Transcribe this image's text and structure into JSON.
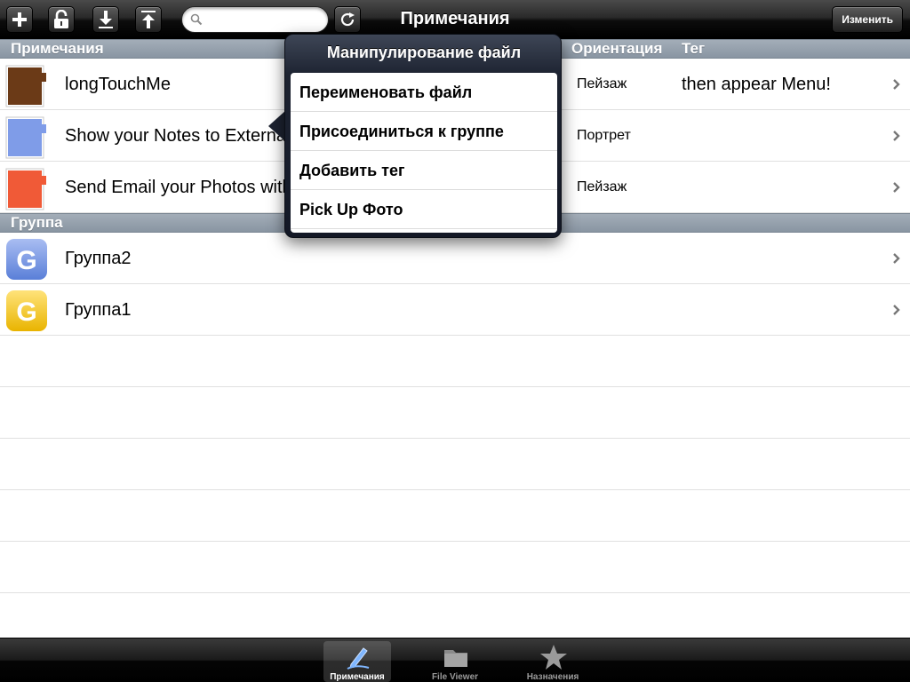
{
  "toolbar": {
    "title": "Примечания",
    "edit_label": "Изменить",
    "search_placeholder": "",
    "buttons": [
      "add-icon",
      "unlock-icon",
      "download-icon",
      "upload-icon",
      "refresh-icon"
    ]
  },
  "notes_section": {
    "header": "Примечания",
    "col_orientation": "Ориентация",
    "col_tag": "Тег",
    "rows": [
      {
        "name": "longTouchMe",
        "orientation": "Пейзаж",
        "tag": "then appear Menu!",
        "color": "#6b3a17"
      },
      {
        "name": "Show your Notes to External Display",
        "orientation": "Портрет",
        "tag": "",
        "color": "#7f9ce8"
      },
      {
        "name": "Send Email your Photos with Notes",
        "orientation": "Пейзаж",
        "tag": "",
        "color": "#f05a37"
      }
    ]
  },
  "group_section": {
    "header": "Группа",
    "rows": [
      {
        "name": "Группа2",
        "letter": "G",
        "color": "#6e8fe0"
      },
      {
        "name": "Группа1",
        "letter": "G",
        "color": "#f2c21a"
      }
    ]
  },
  "popover": {
    "title": "Манипулирование файл",
    "items": [
      "Переименовать файл",
      "Присоединиться к группе",
      "Добавить тег",
      "Pick Up Фото"
    ]
  },
  "tabbar": {
    "tabs": [
      {
        "label": "Примечания",
        "icon": "pen-icon",
        "active": true
      },
      {
        "label": "File Viewer",
        "icon": "folder-icon",
        "active": false
      },
      {
        "label": "Назначения",
        "icon": "star-icon",
        "active": false
      }
    ]
  }
}
